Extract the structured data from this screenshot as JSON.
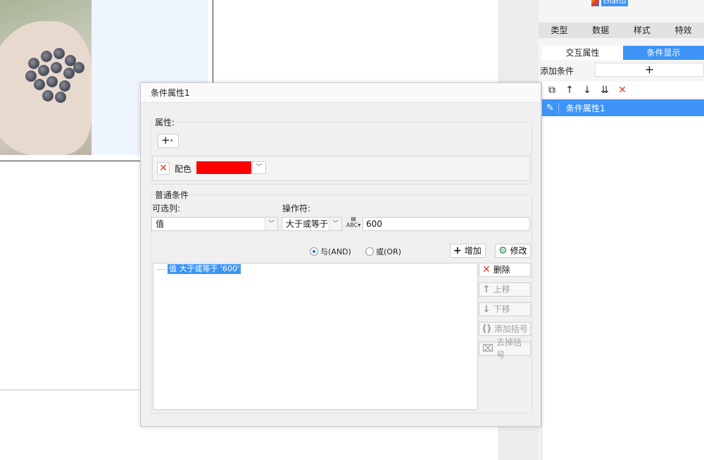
{
  "right_panel": {
    "chart_name": "chart0",
    "tabs": [
      "类型",
      "数据",
      "样式",
      "特效"
    ],
    "subtabs": [
      {
        "label": "交互属性",
        "active": false
      },
      {
        "label": "条件显示",
        "active": true
      }
    ],
    "add_condition_label": "添加条件",
    "add_icon": "plus-icon",
    "toolbar_icons": [
      "copy-icon",
      "arrow-up-icon",
      "arrow-down-icon",
      "sort-icon",
      "delete-icon"
    ],
    "conditions": [
      {
        "label": "条件属性1",
        "selected": true
      }
    ]
  },
  "dialog": {
    "title": "条件属性1",
    "attributes": {
      "legend": "属性:",
      "items": [
        {
          "label": "配色",
          "color": "#ff0000"
        }
      ]
    },
    "normal_conditions": {
      "legend": "普通条件",
      "column_label": "可选列:",
      "column_value": "值",
      "operator_label": "操作符:",
      "operator_value": "大于或等于",
      "value": "600",
      "logic": [
        {
          "label": "与(AND)",
          "selected": true
        },
        {
          "label": "或(OR)",
          "selected": false
        }
      ],
      "add_button": "增加",
      "edit_button": "修改",
      "expressions": [
        "值 大于或等于 '600'"
      ],
      "side_buttons": {
        "delete": "删除",
        "move_up": "上移",
        "move_down": "下移",
        "add_bracket": "添加括号",
        "remove_bracket": "去掉括号"
      }
    }
  },
  "colors": {
    "accent": "#3d94f6",
    "danger": "#e53935",
    "swatch": "#ff0000"
  }
}
